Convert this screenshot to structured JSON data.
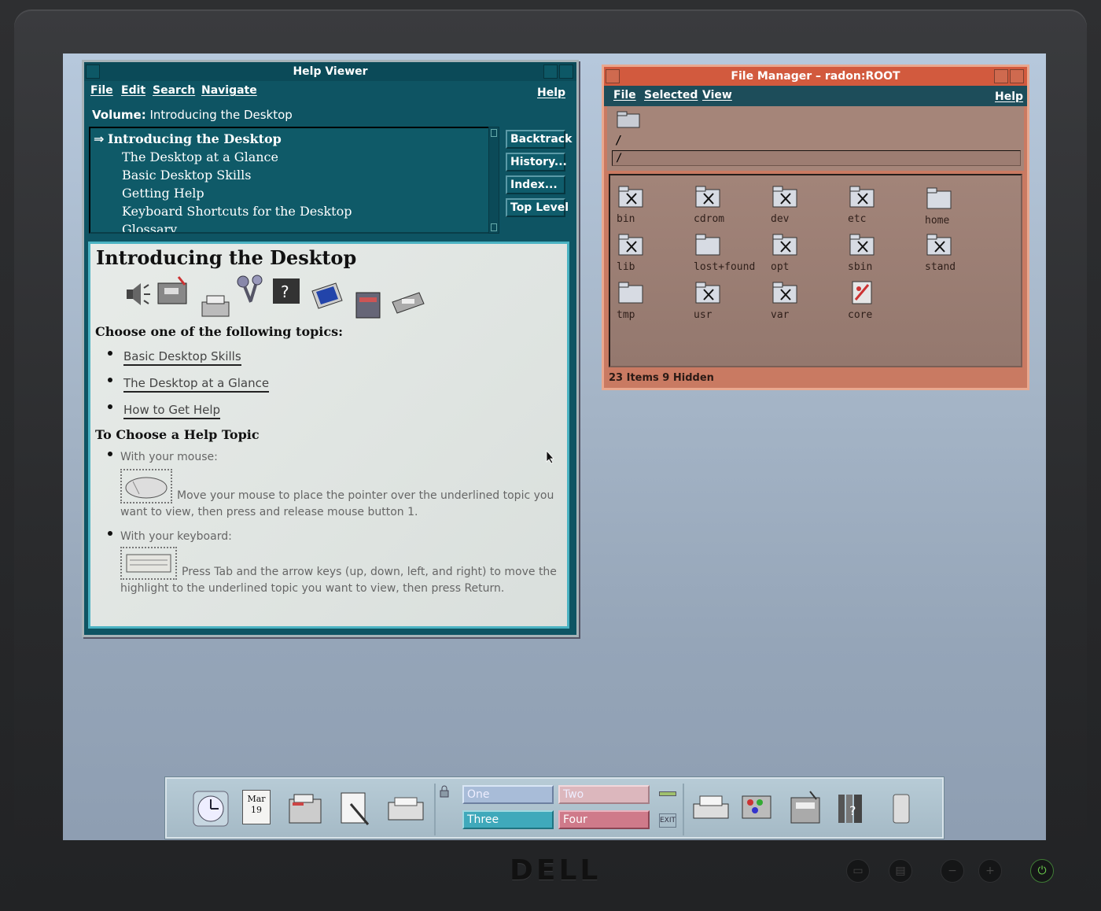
{
  "help_viewer": {
    "title": "Help Viewer",
    "menu": [
      "File",
      "Edit",
      "Search",
      "Navigate"
    ],
    "help_menu": "Help",
    "volume_label": "Volume:",
    "volume_name": "Introducing the Desktop",
    "topics": [
      "Introducing the Desktop",
      "The Desktop at a Glance",
      "Basic Desktop Skills",
      "Getting Help",
      "Keyboard Shortcuts for the Desktop",
      "Glossary"
    ],
    "nav_buttons": [
      "Backtrack",
      "History...",
      "Index...",
      "Top Level"
    ],
    "content": {
      "heading": "Introducing the Desktop",
      "choose_text": "Choose one of the following topics:",
      "links": [
        "Basic Desktop Skills",
        "The Desktop at a Glance",
        "How to Get Help"
      ],
      "section_heading": "To Choose a Help Topic",
      "mouse_label": "With your mouse:",
      "mouse_text_1": "Move your mouse to place the pointer over the underlined topic you",
      "mouse_text_2": "want to view, then press and release mouse button 1.",
      "keyboard_label": "With your keyboard:",
      "keyboard_text_1": "Press Tab and the arrow keys (up, down, left, and right) to move the",
      "keyboard_text_2": "highlight to the underlined topic you want to view, then press Return."
    }
  },
  "file_manager": {
    "title": "File Manager – radon:ROOT",
    "menu": [
      "File",
      "Selected",
      "View"
    ],
    "help_menu": "Help",
    "path_label": "/",
    "path_field": "/",
    "items": [
      {
        "name": "bin",
        "type": "locked-folder"
      },
      {
        "name": "cdrom",
        "type": "locked-folder"
      },
      {
        "name": "dev",
        "type": "locked-folder"
      },
      {
        "name": "etc",
        "type": "locked-folder"
      },
      {
        "name": "home",
        "type": "folder"
      },
      {
        "name": "lib",
        "type": "locked-folder"
      },
      {
        "name": "lost+found",
        "type": "folder"
      },
      {
        "name": "opt",
        "type": "locked-folder"
      },
      {
        "name": "sbin",
        "type": "locked-folder"
      },
      {
        "name": "stand",
        "type": "locked-folder"
      },
      {
        "name": "tmp",
        "type": "folder"
      },
      {
        "name": "usr",
        "type": "locked-folder"
      },
      {
        "name": "var",
        "type": "locked-folder"
      },
      {
        "name": "core",
        "type": "core-file"
      }
    ],
    "status": "23 Items 9 Hidden"
  },
  "front_panel": {
    "date_month": "Mar",
    "date_day": "19",
    "workspaces": [
      "One",
      "Two",
      "Three",
      "Four"
    ],
    "exit_label": "EXIT",
    "icons": [
      "clock-icon",
      "calendar-icon",
      "file-manager-icon",
      "text-editor-icon",
      "mailer-icon",
      "printer-icon",
      "style-manager-icon",
      "application-manager-icon",
      "help-manager-icon",
      "trash-icon"
    ]
  },
  "monitor": {
    "brand": "DELL"
  },
  "colors": {
    "help_viewer_bg": "#0e5463",
    "file_manager_title": "#d25a3e",
    "file_manager_bg": "#c97a62",
    "desktop": "#a4b4c6"
  }
}
